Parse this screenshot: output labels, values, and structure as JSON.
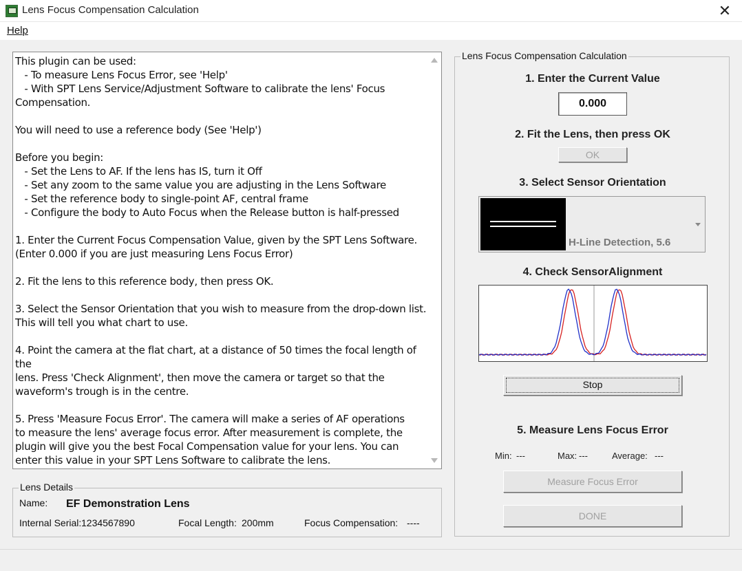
{
  "window": {
    "title": "Lens Focus Compensation Calculation",
    "close_glyph": "✕"
  },
  "menu": {
    "help": "Help"
  },
  "instructions": {
    "text": "This plugin can be used:\n   - To measure Lens Focus Error, see 'Help'\n   - With SPT Lens Service/Adjustment Software to calibrate the lens' Focus\nCompensation.\n\nYou will need to use a reference body (See 'Help')\n\nBefore you begin:\n   - Set the Lens to AF. If the lens has IS, turn it Off\n   - Set any zoom to the same value you are adjusting in the Lens Software\n   - Set the reference body to single-point AF, central frame\n   - Configure the body to Auto Focus when the Release button is half-pressed\n\n1. Enter the Current Focus Compensation Value, given by the SPT Lens Software.\n(Enter 0.000 if you are just measuring Lens Focus Error)\n\n2. Fit the lens to this reference body, then press OK.\n\n3. Select the Sensor Orientation that you wish to measure from the drop-down list.\nThis will tell you what chart to use.\n\n4. Point the camera at the flat chart, at a distance of 50 times the focal length of the\nlens. Press 'Check Alignment', then move the camera or target so that the\nwaveform's trough is in the centre.\n\n5. Press 'Measure Focus Error'. The camera will make a series of AF operations\nto measure the lens' average focus error. After measurement is complete, the\nplugin will give you the best Focal Compensation value for your lens. You can\nenter this value in your SPT Lens Software to calibrate the lens."
  },
  "lens_details": {
    "legend": "Lens Details",
    "name_label": "Name:",
    "name_value": "EF Demonstration Lens",
    "serial_label": "Internal Serial:",
    "serial_value": "1234567890",
    "focal_label": "Focal Length:",
    "focal_value": "200mm",
    "comp_label": "Focus Compensation:",
    "comp_value": "----"
  },
  "calc": {
    "legend": "Lens Focus Compensation Calculation",
    "step1": "1. Enter the Current Value",
    "current_value": "0.000",
    "step2": "2. Fit the Lens, then press OK",
    "ok_label": "OK",
    "step3": "3. Select Sensor Orientation",
    "orientation_value": "H-Line Detection, 5.6",
    "step4": "4. Check SensorAlignment",
    "stop_label": "Stop",
    "step5": "5. Measure Lens Focus Error",
    "min_label": "Min:",
    "min_value": "---",
    "max_label": "Max:",
    "max_value": "---",
    "avg_label": "Average:",
    "avg_value": "---",
    "measure_label": "Measure Focus Error",
    "done_label": "DONE"
  },
  "colors": {
    "waveform_series_a": "#d62020",
    "waveform_series_b": "#2030c8",
    "center_line": "#999999"
  },
  "waveform": {
    "peaks_relative_to_centre": [
      -0.2,
      0.2
    ],
    "baseline_level": 0.05,
    "peak_level": 0.95
  }
}
